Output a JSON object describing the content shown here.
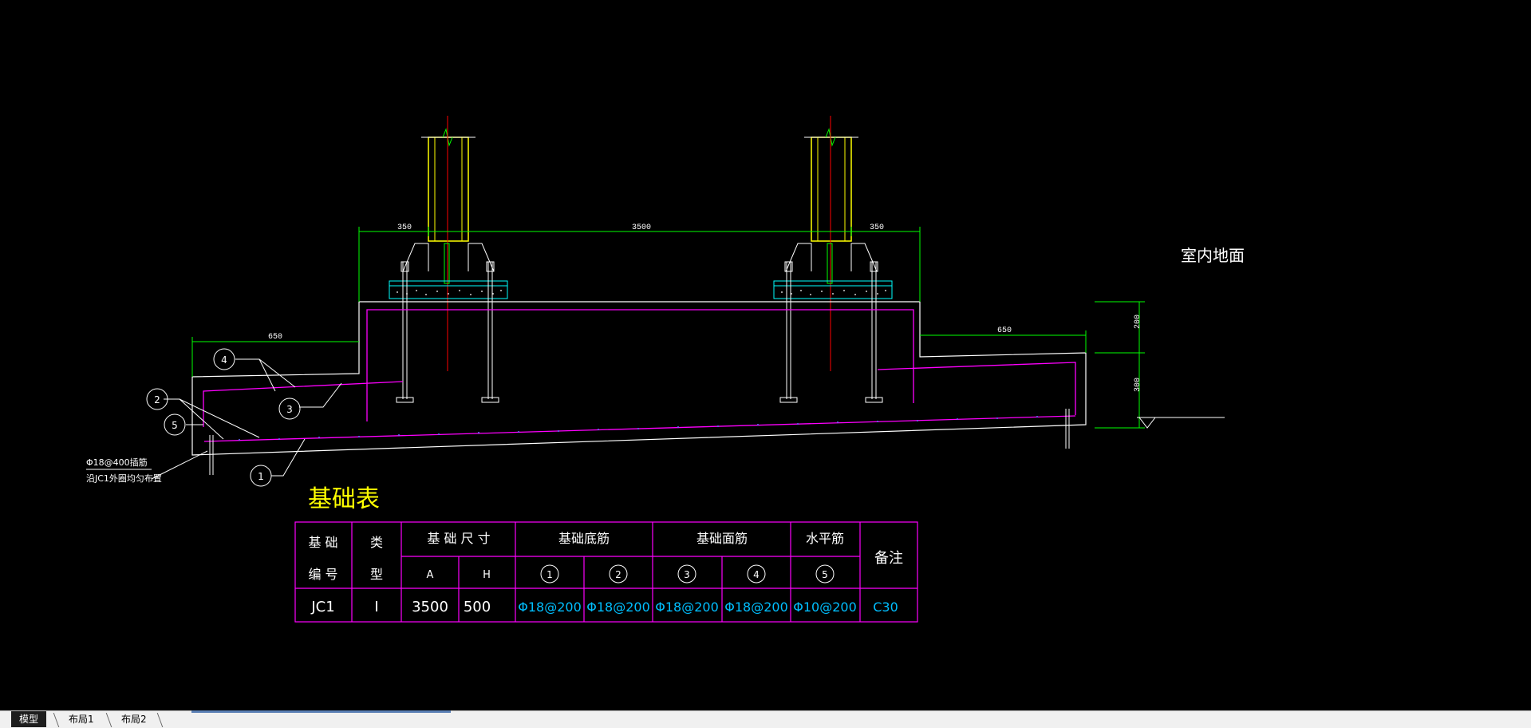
{
  "drawing": {
    "dimensions": {
      "left_offset": "350",
      "span": "3500",
      "right_offset": "350",
      "left_ext": "650",
      "right_ext": "650",
      "upper_h": "200",
      "lower_h": "300"
    },
    "callouts": [
      "4",
      "2",
      "3",
      "5",
      "1"
    ],
    "rebar_note_line1": "Φ18@400插筋",
    "rebar_note_line2": "沿JC1外圈均匀布置",
    "floor_label": "室内地面"
  },
  "table": {
    "title": "基础表",
    "headers": {
      "foundation_no_1": "基 础",
      "foundation_no_2": "编 号",
      "type_1": "类",
      "type_2": "型",
      "size": "基 础 尺 寸",
      "bottom_rebar": "基础底筋",
      "top_rebar": "基础面筋",
      "horizontal_rebar": "水平筋",
      "remark": "备注",
      "col_a": "A",
      "col_h": "H",
      "c1": "1",
      "c2": "2",
      "c3": "3",
      "c4": "4",
      "c5": "5"
    },
    "row": {
      "no": "JC1",
      "type": "I",
      "a": "3500",
      "h": "500",
      "r1": "Φ18@200",
      "r2": "Φ18@200",
      "r3": "Φ18@200",
      "r4": "Φ18@200",
      "r5": "Φ10@200",
      "remark": "C30"
    }
  },
  "tabs": [
    "模型",
    "布局1",
    "布局2"
  ],
  "colors": {
    "outline": "#ffffff",
    "rebar": "#ff00ff",
    "dimension": "#00ff00",
    "column": "#ffff00",
    "axis": "#ff0000",
    "pad": "#00ffff",
    "table_title": "#ffff00",
    "table_value": "#00bfff"
  }
}
